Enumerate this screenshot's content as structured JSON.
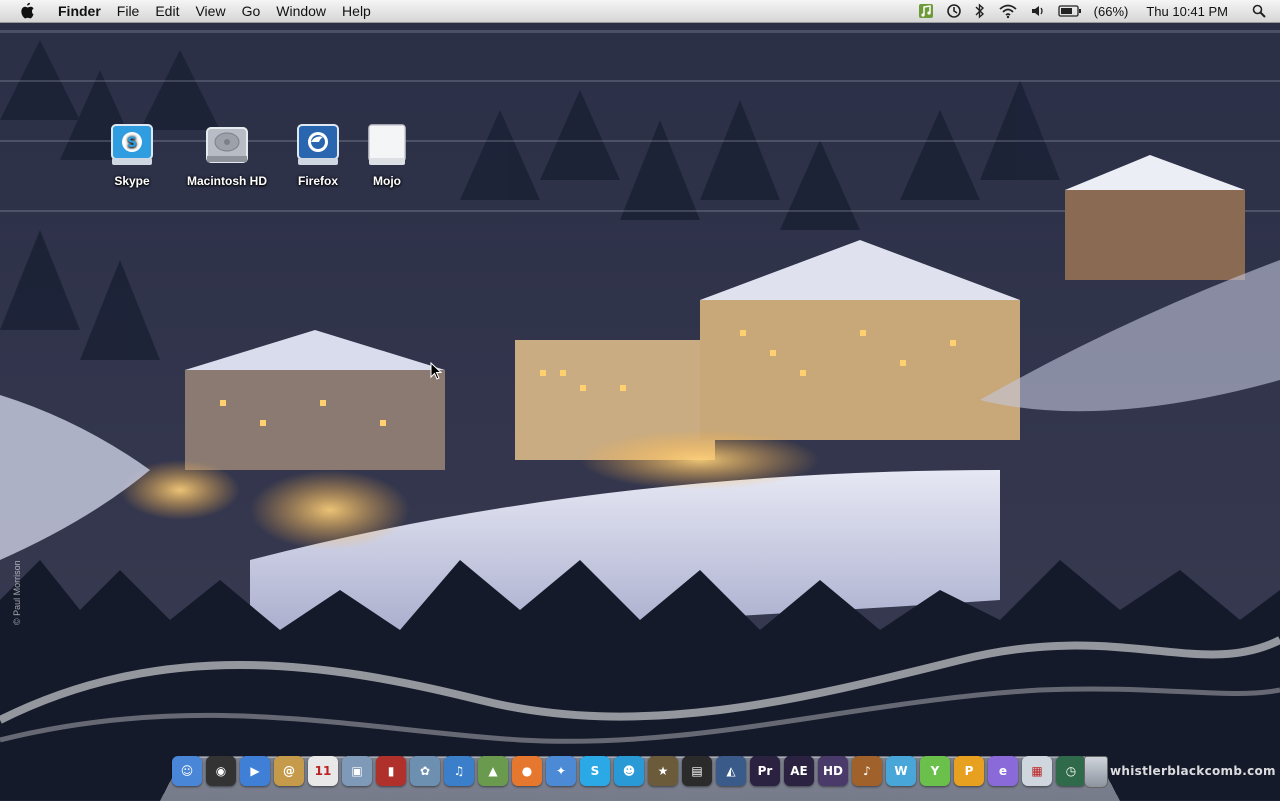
{
  "menubar": {
    "app_name": "Finder",
    "menus": [
      "File",
      "Edit",
      "View",
      "Go",
      "Window",
      "Help"
    ],
    "battery_percent": "(66%)",
    "clock": "Thu 10:41 PM"
  },
  "desktop_icons": [
    {
      "label": "Skype",
      "icon": "skype-drive-icon"
    },
    {
      "label": "Macintosh HD",
      "icon": "hard-drive-icon"
    },
    {
      "label": "Firefox",
      "icon": "firefox-drive-icon"
    },
    {
      "label": "Mojo",
      "icon": "white-drive-icon"
    }
  ],
  "dock": {
    "items": [
      {
        "name": "finder",
        "color": "#4a86d8",
        "glyph": "☺"
      },
      {
        "name": "dashboard",
        "color": "#333333",
        "glyph": "◉"
      },
      {
        "name": "facetime",
        "color": "#3f7fd6",
        "glyph": "▶"
      },
      {
        "name": "address-book",
        "color": "#c59a4a",
        "glyph": "@"
      },
      {
        "name": "ical",
        "color": "#e8e8e8",
        "glyph": "11"
      },
      {
        "name": "preview",
        "color": "#7f9ab8",
        "glyph": "▣"
      },
      {
        "name": "photo-booth",
        "color": "#b0312b",
        "glyph": "▮"
      },
      {
        "name": "iphoto",
        "color": "#6d8fb0",
        "glyph": "✿"
      },
      {
        "name": "itunes",
        "color": "#3b7ec9",
        "glyph": "♫"
      },
      {
        "name": "maps",
        "color": "#6a9a4e",
        "glyph": "▲"
      },
      {
        "name": "firefox",
        "color": "#e6772e",
        "glyph": "●"
      },
      {
        "name": "safari",
        "color": "#4d8ad6",
        "glyph": "✦"
      },
      {
        "name": "skype",
        "color": "#2aa9e6",
        "glyph": "S"
      },
      {
        "name": "ichat",
        "color": "#2a9ad6",
        "glyph": "☻"
      },
      {
        "name": "imovie",
        "color": "#6b5b3a",
        "glyph": "★"
      },
      {
        "name": "final-cut",
        "color": "#2b2b2b",
        "glyph": "▤"
      },
      {
        "name": "aperture",
        "color": "#3a5a8a",
        "glyph": "◭"
      },
      {
        "name": "premiere",
        "color": "#2a2240",
        "glyph": "Pr"
      },
      {
        "name": "after-effects",
        "color": "#2a2240",
        "glyph": "AE"
      },
      {
        "name": "hd-app",
        "color": "#4a3a6a",
        "glyph": "HD"
      },
      {
        "name": "garageband",
        "color": "#a0622a",
        "glyph": "♪"
      },
      {
        "name": "app-w",
        "color": "#49a6d8",
        "glyph": "W"
      },
      {
        "name": "app-y",
        "color": "#6ac04a",
        "glyph": "Y"
      },
      {
        "name": "app-p",
        "color": "#e8a020",
        "glyph": "P"
      },
      {
        "name": "app-e",
        "color": "#8a6ad8",
        "glyph": "e"
      },
      {
        "name": "preview-docs",
        "color": "#d0d6de",
        "glyph": "▦"
      },
      {
        "name": "time-machine",
        "color": "#2f6a4a",
        "glyph": "◷"
      }
    ]
  },
  "wallpaper": {
    "watermark": "whistlerblackcomb.com",
    "credit": "© Paul Morrison"
  }
}
